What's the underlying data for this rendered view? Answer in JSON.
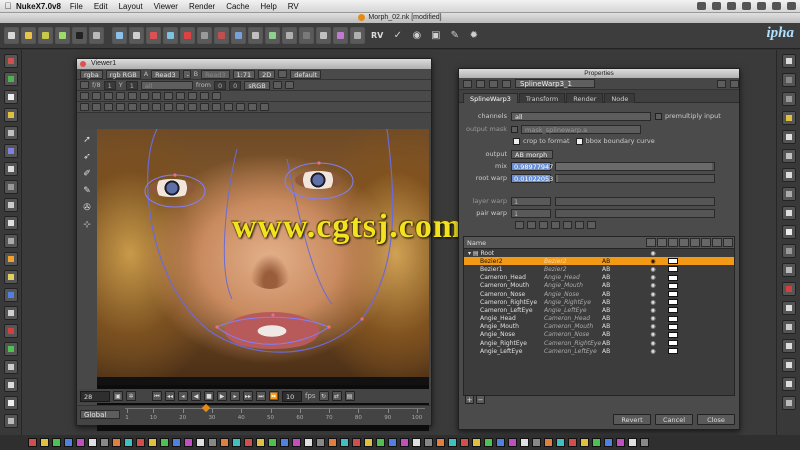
{
  "menubar": {
    "app_name": "NukeX7.0v8",
    "menus": [
      "File",
      "Edit",
      "Layout",
      "Viewer",
      "Render",
      "Cache",
      "Help",
      "RV"
    ]
  },
  "window": {
    "title": "Morph_02.nk [modified]"
  },
  "toolbar": {
    "rv_label": "RV",
    "logo_text": "ipha"
  },
  "viewer": {
    "title": "Viewer1",
    "row1": {
      "channels": "rgba",
      "layer": "rgb  RGB",
      "a_label": "A",
      "a_input": "Read3",
      "b_label": "B",
      "b_input": "Read3",
      "zoom": "1:71",
      "view": "2D",
      "lut": "default"
    },
    "row2": {
      "gain_label": "f/8",
      "gain_value": "1",
      "y_label": "Y",
      "gamma_value": "1",
      "roi_label": "all",
      "from_label": "from",
      "from_value": "0",
      "from_value2": "0",
      "colorspace": "sRGB"
    },
    "image_watermark": "www.cgtsj.com",
    "timeline": {
      "current_frame": "28",
      "fps_value": "10",
      "fps_label": "fps",
      "range_mode": "Global",
      "ruler_labels": [
        "1",
        "10",
        "20",
        "30",
        "40",
        "50",
        "60",
        "70",
        "80",
        "90",
        "100"
      ]
    }
  },
  "properties": {
    "title": "Properties",
    "node_name": "SplineWarp3_1",
    "tabs": [
      "SplineWarp3",
      "Transform",
      "Render",
      "Node"
    ],
    "channels_label": "channels",
    "channels_value": "all",
    "premultiply_label": "premultiply",
    "premultiply_value": "input",
    "output_mask_label": "output mask",
    "output_mask_value": "mask_splinewarp.a",
    "crop_to_format_label": "crop to format",
    "bbox_label": "bbox boundary curve",
    "output_label": "output",
    "output_value": "AB morph",
    "mix_label": "mix",
    "mix_value": "0.98977947",
    "root_warp_label": "root warp",
    "root_warp_value": "0.01022053",
    "layer_warp_label": "layer warp",
    "layer_warp_value": "1",
    "pair_warp_label": "pair warp",
    "pair_warp_value": "1",
    "table": {
      "column_name": "Name",
      "root_label": "Root",
      "rows": [
        {
          "name": "Bezier2",
          "source": "Bezier2",
          "output": "AB",
          "selected": true
        },
        {
          "name": "Bezier1",
          "source": "Bezier2",
          "output": "AB",
          "selected": false
        },
        {
          "name": "Cameron_Head",
          "source": "Angie_Head",
          "output": "AB",
          "selected": false
        },
        {
          "name": "Cameron_Mouth",
          "source": "Angie_Mouth",
          "output": "AB",
          "selected": false
        },
        {
          "name": "Cameron_Nose",
          "source": "Angie_Nose",
          "output": "AB",
          "selected": false
        },
        {
          "name": "Cameron_RightEye",
          "source": "Angie_RightEye",
          "output": "AB",
          "selected": false
        },
        {
          "name": "Cameron_LeftEye",
          "source": "Angie_LeftEye",
          "output": "AB",
          "selected": false
        },
        {
          "name": "Angie_Head",
          "source": "Cameron_Head",
          "output": "AB",
          "selected": false
        },
        {
          "name": "Angie_Mouth",
          "source": "Cameron_Mouth",
          "output": "AB",
          "selected": false
        },
        {
          "name": "Angie_Nose",
          "source": "Cameron_Nose",
          "output": "AB",
          "selected": false
        },
        {
          "name": "Angie_RightEye",
          "source": "Cameron_RightEye",
          "output": "AB",
          "selected": false
        },
        {
          "name": "Angie_LeftEye",
          "source": "Cameron_LeftEye",
          "output": "AB",
          "selected": false
        }
      ]
    },
    "buttons": {
      "revert": "Revert",
      "cancel": "Cancel",
      "close": "Close",
      "add": "+",
      "remove": "−"
    }
  },
  "colors": {
    "selection": "#f29a16",
    "value_field": "#6b8fd4",
    "watermark": "#f3e21f",
    "node_orange": "#e48a1b"
  }
}
